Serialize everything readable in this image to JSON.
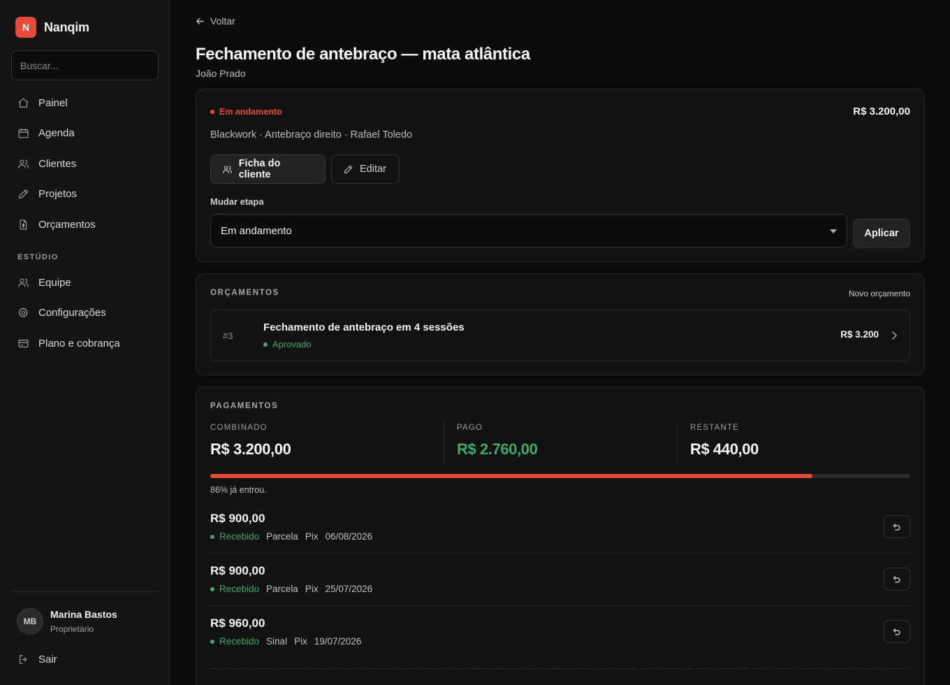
{
  "app": {
    "logo_letter": "N",
    "name": "Nanqim"
  },
  "search": {
    "placeholder": "Buscar..."
  },
  "sidebar": {
    "nav": [
      {
        "label": "Painel",
        "icon": "home-icon"
      },
      {
        "label": "Agenda",
        "icon": "calendar-icon"
      },
      {
        "label": "Clientes",
        "icon": "users-icon"
      },
      {
        "label": "Projetos",
        "icon": "pencil-icon"
      },
      {
        "label": "Orçamentos",
        "icon": "document-dollar-icon"
      }
    ],
    "section_label": "ESTÚDIO",
    "studio": [
      {
        "label": "Equipe",
        "icon": "team-icon"
      },
      {
        "label": "Configurações",
        "icon": "gear-icon"
      },
      {
        "label": "Plano e cobrança",
        "icon": "credit-card-icon"
      }
    ],
    "user": {
      "initials": "MB",
      "name": "Marina Bastos",
      "role": "Proprietário"
    },
    "logout_label": "Sair"
  },
  "page": {
    "back_label": "Voltar",
    "title": "Fechamento de antebraço — mata atlântica",
    "subtitle": "João Prado"
  },
  "project": {
    "status": "Em andamento",
    "status_color": "#e54b36",
    "amount": "R$ 3.200,00",
    "meta": "Blackwork · Antebraço direito · Rafael Toledo",
    "client_button": "Ficha do cliente",
    "edit_button": "Editar",
    "stage_label": "Mudar etapa",
    "stage_value": "Em andamento",
    "apply_button": "Aplicar"
  },
  "quotes": {
    "heading": "ORÇAMENTOS",
    "new_link": "Novo orçamento",
    "items": [
      {
        "number": "#3",
        "title": "Fechamento de antebraço em 4 sessões",
        "status": "Aprovado",
        "amount": "R$ 3.200"
      }
    ]
  },
  "payments": {
    "heading": "PAGAMENTOS",
    "combined_label": "COMBINADO",
    "combined_value": "R$ 3.200,00",
    "paid_label": "PAGO",
    "paid_value": "R$ 2.760,00",
    "remaining_label": "RESTANTE",
    "remaining_value": "R$ 440,00",
    "progress_percent": 86,
    "progress_caption": "86% já entrou.",
    "items": [
      {
        "amount": "R$ 900,00",
        "status": "Recebido",
        "type": "Parcela",
        "method": "Pix",
        "date": "06/08/2026"
      },
      {
        "amount": "R$ 900,00",
        "status": "Recebido",
        "type": "Parcela",
        "method": "Pix",
        "date": "25/07/2026"
      },
      {
        "amount": "R$ 960,00",
        "status": "Recebido",
        "type": "Sinal",
        "method": "Pix",
        "date": "19/07/2026"
      }
    ]
  },
  "colors": {
    "accent": "#e54b36",
    "success": "#3fa86a",
    "background": "#0b0b0b",
    "surface": "#121212"
  }
}
